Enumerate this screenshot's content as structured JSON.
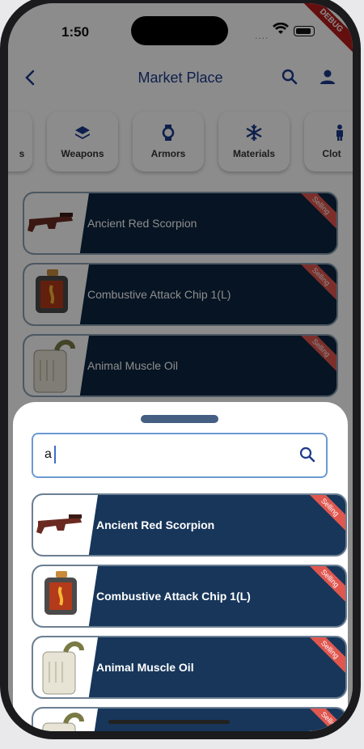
{
  "status_bar": {
    "time": "1:50",
    "signal": "....",
    "debug_banner": "DEBUG"
  },
  "app_bar": {
    "title": "Market Place",
    "icons": [
      "back-icon",
      "search-icon",
      "person-icon"
    ]
  },
  "categories": [
    {
      "label": "s",
      "icon": "partial-icon"
    },
    {
      "label": "Weapons",
      "icon": "layers-icon"
    },
    {
      "label": "Armors",
      "icon": "watch-icon"
    },
    {
      "label": "Materials",
      "icon": "snowflake-icon"
    },
    {
      "label": "Clot",
      "icon": "person-icon"
    }
  ],
  "background_items": [
    {
      "name": "Ancient Red Scorpion",
      "badge": "Selling"
    },
    {
      "name": "Combustive Attack Chip 1(L)",
      "badge": "Selling"
    },
    {
      "name": "Animal Muscle Oil",
      "badge": "Selling"
    }
  ],
  "sheet": {
    "search_value": "a",
    "results": [
      {
        "name": "Ancient Red Scorpion",
        "badge": "Selling"
      },
      {
        "name": "Combustive Attack Chip 1(L)",
        "badge": "Selling"
      },
      {
        "name": "Animal Muscle Oil",
        "badge": "Selling"
      },
      {
        "name": "",
        "badge": "Selling"
      }
    ]
  },
  "colors": {
    "accent": "#1d3a8a",
    "card_bg": "#0c2540",
    "badge": "#e0574f",
    "search_border": "#6a9ad3"
  }
}
